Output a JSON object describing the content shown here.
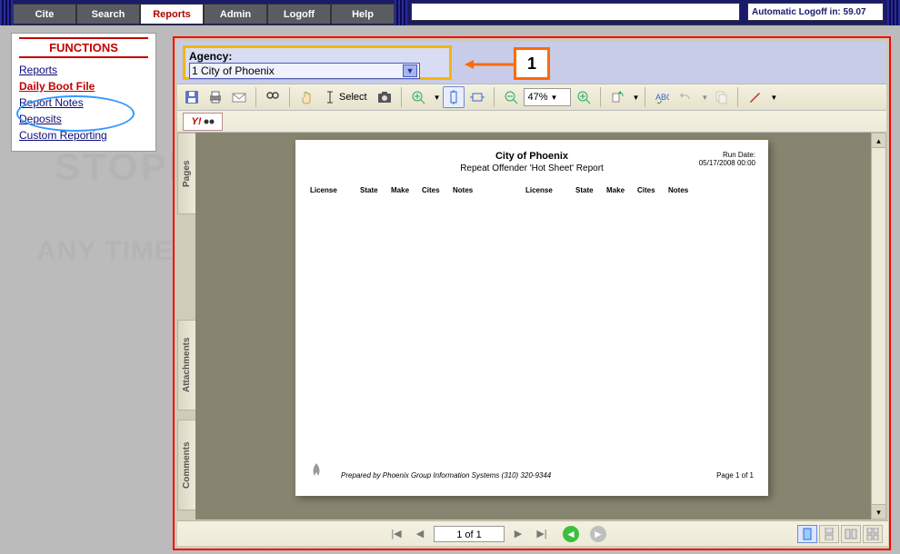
{
  "nav": {
    "tabs": [
      "Cite",
      "Search",
      "Reports",
      "Admin",
      "Logoff",
      "Help"
    ],
    "active": "Reports",
    "logoff_label": "Automatic Logoff in:",
    "logoff_time": "59.07"
  },
  "functions": {
    "heading": "FUNCTIONS",
    "links": [
      {
        "label": "Reports",
        "highlight": false
      },
      {
        "label": "Daily Boot File",
        "highlight": true
      },
      {
        "label": "Report Notes",
        "highlight": false
      },
      {
        "label": "Deposits",
        "highlight": false
      },
      {
        "label": "Custom Reporting",
        "highlight": false
      }
    ]
  },
  "agency": {
    "label": "Agency:",
    "value": "1 City of Phoenix"
  },
  "callouts": {
    "one": "1"
  },
  "toolbar": {
    "select_label": "Select",
    "zoom_value": "47%"
  },
  "subbar": {
    "yahoo": "Y!"
  },
  "sidetabs": {
    "pages": "Pages",
    "attachments": "Attachments",
    "comments": "Comments"
  },
  "report": {
    "title1": "City of Phoenix",
    "title2": "Repeat Offender 'Hot Sheet' Report",
    "run_date_label": "Run Date:",
    "run_date_value": "05/17/2008 00:00",
    "columns": [
      "License",
      "State",
      "Make",
      "Cites",
      "Notes"
    ],
    "footer_prepared": "Prepared by Phoenix Group Information Systems (310) 320-9344",
    "footer_page": "Page 1 of 1"
  },
  "status": {
    "page_field": "1 of 1"
  }
}
